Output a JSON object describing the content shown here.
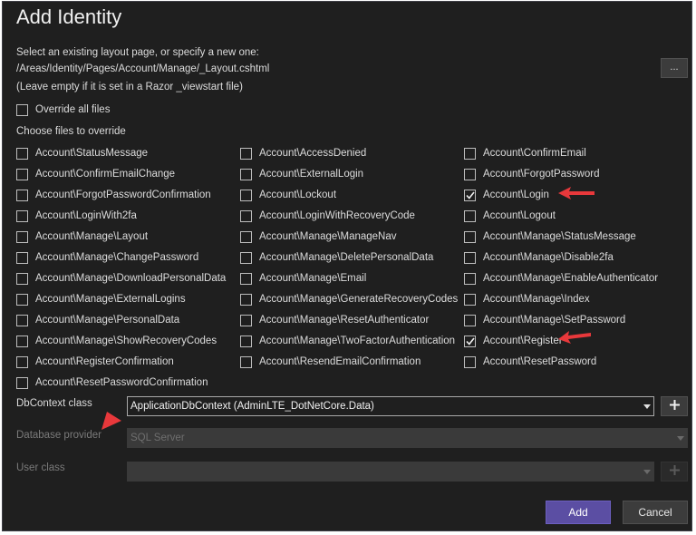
{
  "dialog": {
    "title": "Add Identity",
    "layout_prompt": "Select an existing layout page, or specify a new one:",
    "layout_path": "/Areas/Identity/Pages/Account/Manage/_Layout.cshtml",
    "layout_hint": "(Leave empty if it is set in a Razor _viewstart file)",
    "browse_label": "...",
    "override_all_label": "Override all files",
    "override_all_checked": false,
    "choose_files_label": "Choose files to override"
  },
  "files": {
    "col1": [
      {
        "label": "Account\\StatusMessage",
        "checked": false
      },
      {
        "label": "Account\\ConfirmEmailChange",
        "checked": false
      },
      {
        "label": "Account\\ForgotPasswordConfirmation",
        "checked": false
      },
      {
        "label": "Account\\LoginWith2fa",
        "checked": false
      },
      {
        "label": "Account\\Manage\\Layout",
        "checked": false
      },
      {
        "label": "Account\\Manage\\ChangePassword",
        "checked": false
      },
      {
        "label": "Account\\Manage\\DownloadPersonalData",
        "checked": false
      },
      {
        "label": "Account\\Manage\\ExternalLogins",
        "checked": false
      },
      {
        "label": "Account\\Manage\\PersonalData",
        "checked": false
      },
      {
        "label": "Account\\Manage\\ShowRecoveryCodes",
        "checked": false
      },
      {
        "label": "Account\\RegisterConfirmation",
        "checked": false
      },
      {
        "label": "Account\\ResetPasswordConfirmation",
        "checked": false
      }
    ],
    "col2": [
      {
        "label": "Account\\AccessDenied",
        "checked": false
      },
      {
        "label": "Account\\ExternalLogin",
        "checked": false
      },
      {
        "label": "Account\\Lockout",
        "checked": false
      },
      {
        "label": "Account\\LoginWithRecoveryCode",
        "checked": false
      },
      {
        "label": "Account\\Manage\\ManageNav",
        "checked": false
      },
      {
        "label": "Account\\Manage\\DeletePersonalData",
        "checked": false
      },
      {
        "label": "Account\\Manage\\Email",
        "checked": false
      },
      {
        "label": "Account\\Manage\\GenerateRecoveryCodes",
        "checked": false
      },
      {
        "label": "Account\\Manage\\ResetAuthenticator",
        "checked": false
      },
      {
        "label": "Account\\Manage\\TwoFactorAuthentication",
        "checked": false
      },
      {
        "label": "Account\\ResendEmailConfirmation",
        "checked": false
      }
    ],
    "col3": [
      {
        "label": "Account\\ConfirmEmail",
        "checked": false
      },
      {
        "label": "Account\\ForgotPassword",
        "checked": false
      },
      {
        "label": "Account\\Login",
        "checked": true
      },
      {
        "label": "Account\\Logout",
        "checked": false
      },
      {
        "label": "Account\\Manage\\StatusMessage",
        "checked": false
      },
      {
        "label": "Account\\Manage\\Disable2fa",
        "checked": false
      },
      {
        "label": "Account\\Manage\\EnableAuthenticator",
        "checked": false
      },
      {
        "label": "Account\\Manage\\Index",
        "checked": false
      },
      {
        "label": "Account\\Manage\\SetPassword",
        "checked": false
      },
      {
        "label": "Account\\Register",
        "checked": true
      },
      {
        "label": "Account\\ResetPassword",
        "checked": false
      }
    ]
  },
  "dbcontext": {
    "label": "DbContext class",
    "value": "ApplicationDbContext (AdminLTE_DotNetCore.Data)"
  },
  "dbprovider": {
    "label": "Database provider",
    "value": "SQL Server"
  },
  "userclass": {
    "label": "User class",
    "value": ""
  },
  "buttons": {
    "add": "Add",
    "cancel": "Cancel"
  },
  "colors": {
    "annotation_arrow": "#e8383b",
    "primary": "#5b4ea3"
  }
}
